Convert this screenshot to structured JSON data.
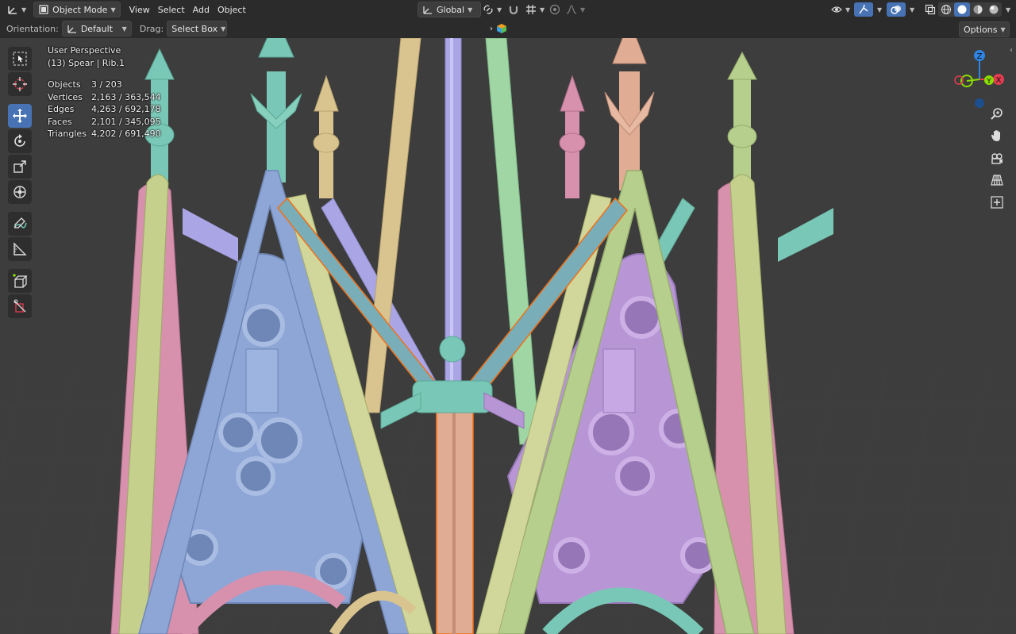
{
  "header": {
    "mode": "Object Mode",
    "menus": [
      "View",
      "Select",
      "Add",
      "Object"
    ],
    "transform_orientation": "Global"
  },
  "tool_header": {
    "orientation_label": "Orientation:",
    "orientation_value": "Default",
    "drag_label": "Drag:",
    "drag_value": "Select Box",
    "options": "Options"
  },
  "overlay": {
    "perspective": "User Perspective",
    "selection": "(13) Spear | Rib.1",
    "stats": [
      {
        "label": "Objects",
        "value": "3 / 203"
      },
      {
        "label": "Vertices",
        "value": "2,163 / 363,544"
      },
      {
        "label": "Edges",
        "value": "4,263 / 692,178"
      },
      {
        "label": "Faces",
        "value": "2,101 / 345,095"
      },
      {
        "label": "Triangles",
        "value": "4,202 / 691,490"
      }
    ]
  },
  "toolbar": {
    "tools": [
      "select-box-tool",
      "cursor-tool",
      "move-tool",
      "rotate-tool",
      "scale-tool",
      "transform-tool",
      "annotate-tool",
      "measure-tool",
      "add-cube-tool",
      "transform-custom-tool"
    ],
    "active": "move-tool"
  },
  "gizmo": {
    "z": "Z",
    "y": "Y",
    "x": "X"
  },
  "colors": {
    "accent": "#4772b3",
    "x_axis": "#e33c4f",
    "y_axis": "#8bdc00",
    "z_axis": "#2f83e3",
    "selection_outline": "#f07018",
    "green": "#b7cf8c",
    "blue": "#8ea6d6",
    "pink": "#d791ad",
    "teal": "#79c7b6",
    "peach": "#e0ac93",
    "purple": "#b896d6",
    "tan": "#d9c48f",
    "lavender": "#aaa6e6"
  }
}
